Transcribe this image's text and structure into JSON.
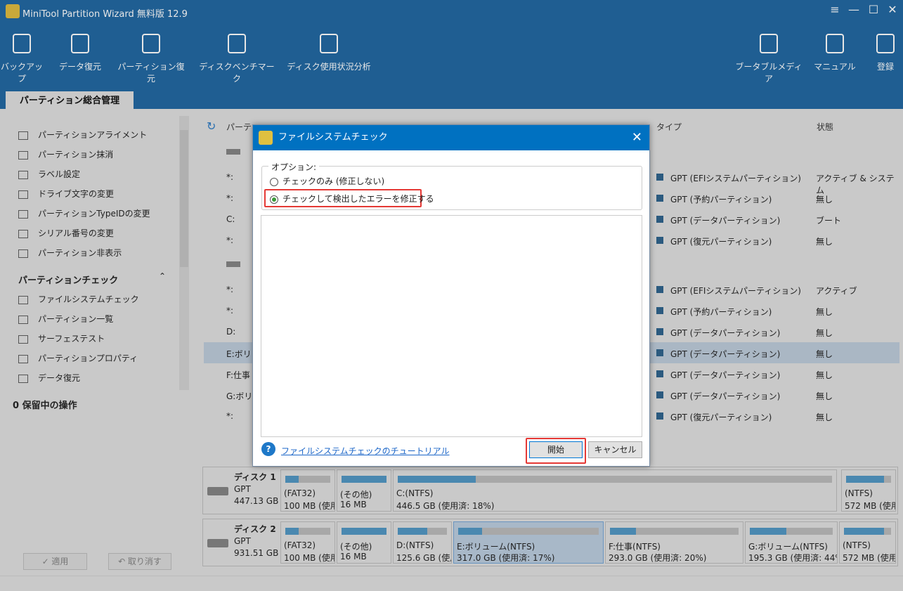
{
  "app": {
    "title": "MiniTool Partition Wizard 無料版 12.9"
  },
  "toolbar": [
    "バックアップ",
    "データ復元",
    "パーティション復元",
    "ディスクベンチマーク",
    "ディスク使用状況分析"
  ],
  "toolbar_right": [
    "ブータブルメディア",
    "マニュアル",
    "登録"
  ],
  "tab": "パーティション総合管理",
  "sidebar": {
    "items": [
      "パーティションアライメント",
      "パーティション抹消",
      "ラベル設定",
      "ドライブ文字の変更",
      "パーティションTypeIDの変更",
      "シリアル番号の変更",
      "パーティション非表示"
    ],
    "section": "パーティションチェック",
    "check_items": [
      "ファイルシステムチェック",
      "パーティション一覧",
      "サーフェステスト",
      "パーティションプロパティ",
      "データ復元"
    ],
    "pending": "0 保留中の操作",
    "apply": "✓ 適用",
    "undo": "↶ 取り消す"
  },
  "table": {
    "col_partition": "パーティ",
    "col_type": "タイプ",
    "col_status": "状態",
    "rows": [
      {
        "p": "*:",
        "type": "GPT (EFIシステムパーティション)",
        "status": "アクティブ & システム"
      },
      {
        "p": "*:",
        "type": "GPT (予約パーティション)",
        "status": "無し"
      },
      {
        "p": "C:",
        "type": "GPT (データパーティション)",
        "status": "ブート"
      },
      {
        "p": "*:",
        "type": "GPT (復元パーティション)",
        "status": "無し"
      },
      {
        "p": "*:",
        "type": "GPT (EFIシステムパーティション)",
        "status": "アクティブ"
      },
      {
        "p": "*:",
        "type": "GPT (予約パーティション)",
        "status": "無し"
      },
      {
        "p": "D:",
        "type": "GPT (データパーティション)",
        "status": "無し"
      },
      {
        "p": "E:ボリュ",
        "type": "GPT (データパーティション)",
        "status": "無し"
      },
      {
        "p": "F:仕事",
        "type": "GPT (データパーティション)",
        "status": "無し"
      },
      {
        "p": "G:ボリュ",
        "type": "GPT (データパーティション)",
        "status": "無し"
      },
      {
        "p": "*:",
        "type": "GPT (復元パーティション)",
        "status": "無し"
      }
    ]
  },
  "dialog": {
    "title": "ファイルシステムチェック",
    "options_label": "オプション:",
    "opt1": "チェックのみ (修正しない)",
    "opt2": "チェックして検出したエラーを修正する",
    "selected": 2,
    "tutorial": "ファイルシステムチェックのチュートリアル",
    "start": "開始",
    "cancel": "キャンセル"
  },
  "disks": [
    {
      "name": "ディスク 1",
      "style": "GPT",
      "size": "447.13 GB",
      "parts": [
        {
          "l1": "(FAT32)",
          "l2": "100 MB (使用",
          "used": 0.3
        },
        {
          "l1": "(その他)",
          "l2": "16 MB",
          "used": 1.0
        },
        {
          "l1": "C:(NTFS)",
          "l2": "446.5 GB (使用済: 18%)",
          "used": 0.18
        },
        {
          "l1": "(NTFS)",
          "l2": "572 MB (使用",
          "used": 0.85
        }
      ]
    },
    {
      "name": "ディスク 2",
      "style": "GPT",
      "size": "931.51 GB",
      "parts": [
        {
          "l1": "(FAT32)",
          "l2": "100 MB (使用",
          "used": 0.3
        },
        {
          "l1": "(その他)",
          "l2": "16 MB",
          "used": 1.0
        },
        {
          "l1": "D:(NTFS)",
          "l2": "125.6 GB (使用",
          "used": 0.6
        },
        {
          "l1": "E:ボリューム(NTFS)",
          "l2": "317.0 GB (使用済: 17%)",
          "used": 0.17
        },
        {
          "l1": "F:仕事(NTFS)",
          "l2": "293.0 GB (使用済: 20%)",
          "used": 0.2
        },
        {
          "l1": "G:ボリューム(NTFS)",
          "l2": "195.3 GB (使用済: 44%",
          "used": 0.44
        },
        {
          "l1": "(NTFS)",
          "l2": "572 MB (使用",
          "used": 0.85
        }
      ]
    }
  ]
}
